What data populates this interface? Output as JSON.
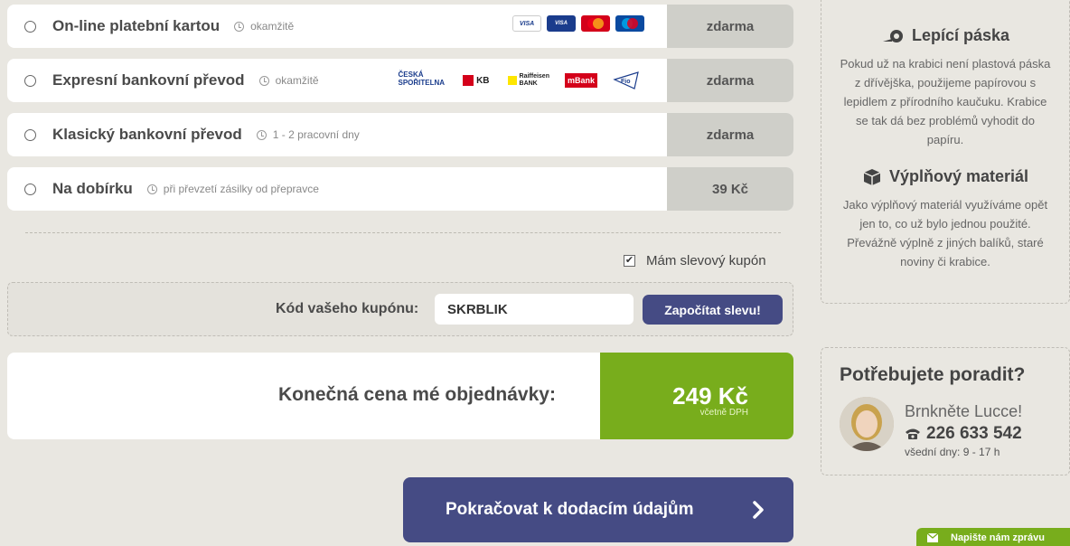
{
  "payment_methods": [
    {
      "name": "On-line platební kartou",
      "time": "okamžitě",
      "price": "zdarma"
    },
    {
      "name": "Expresní bankovní převod",
      "time": "okamžitě",
      "price": "zdarma"
    },
    {
      "name": "Klasický bankovní převod",
      "time": "1 - 2 pracovní dny",
      "price": "zdarma"
    },
    {
      "name": "Na dobírku",
      "time": "při převzetí zásilky od přepravce",
      "price": "39 Kč"
    }
  ],
  "card_logos": [
    "VISA",
    "VISA Electron",
    "MasterCard",
    "Maestro"
  ],
  "bank_logos": [
    "ČESKÁ SPOŘITELNA",
    "KB",
    "Raiffeisen BANK",
    "mBank",
    "Fio banka"
  ],
  "coupon": {
    "checkbox_label": "Mám slevový kupón",
    "label": "Kód vašeho kupónu:",
    "value": "SKRBLIK",
    "button": "Započítat slevu!"
  },
  "total": {
    "label": "Konečná cena mé objednávky:",
    "amount": "249 Kč",
    "vat": "včetně DPH"
  },
  "continue_button": "Pokračovat k dodacím údajům",
  "sidebar": {
    "tape_title": "Lepící páska",
    "tape_text": "Pokud už na krabici není plastová páska z dřívějška, použijeme papírovou s lepidlem z přírodního kaučuku. Krabice se tak dá bez problémů vyhodit do papíru.",
    "fill_title": "Výplňový materiál",
    "fill_text": "Jako výplňový materiál využíváme opět jen to, co už bylo jednou použité. Převážně výplně z jiných balíků, staré noviny či krabice.",
    "contact_title": "Potřebujete poradit?",
    "contact_call": "Brnkněte Lucce!",
    "contact_phone": "226 633 542",
    "contact_hours": "všední dny: 9 - 17 h"
  },
  "chat_tab": "Napište nám zprávu",
  "colors": {
    "accent_green": "#78ad1c",
    "button_blue": "#454b84",
    "price_gray": "#cfcfc9"
  }
}
